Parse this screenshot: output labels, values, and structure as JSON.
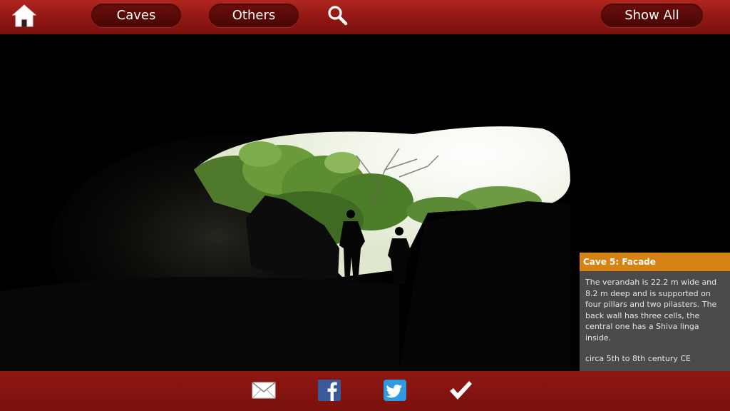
{
  "topbar": {
    "home_icon": "home-icon",
    "caves_label": "Caves",
    "others_label": "Others",
    "search_icon": "search-icon",
    "show_all_label": "Show All"
  },
  "photo": {
    "subject": "cave-entrance-photo"
  },
  "caption": {
    "title": "Cave 5: Facade",
    "description": "The verandah is 22.2 m wide and 8.2 m deep and is supported on four pillars and two pilasters. The back wall has three cells, the central one has a Shiva linga inside.",
    "date": "circa 5th to 8th century CE"
  },
  "bottombar": {
    "icons": [
      "email-icon",
      "facebook-icon",
      "twitter-icon",
      "checkmark-icon"
    ]
  },
  "colors": {
    "bar_red": "#8f1712",
    "pill_dark": "#4a0705",
    "caption_orange": "#d48314",
    "caption_gray": "#4b4b4b",
    "facebook_blue": "#3b5998",
    "twitter_blue": "#2f9ae0"
  }
}
